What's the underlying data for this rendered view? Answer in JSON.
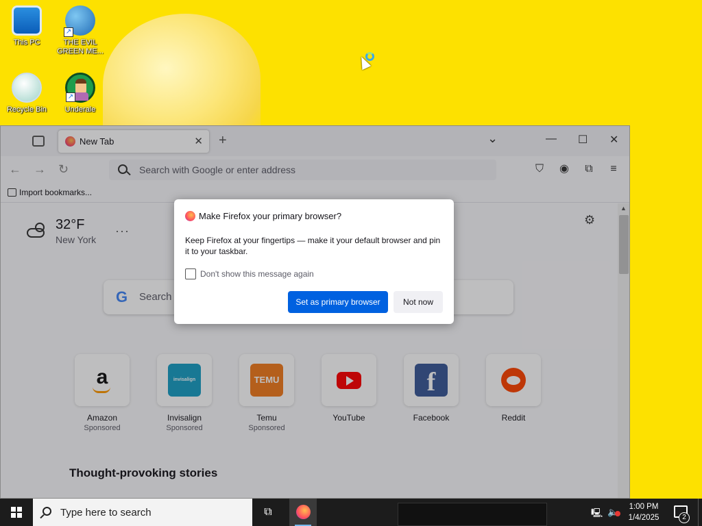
{
  "desktop": {
    "icons": [
      {
        "label": "This PC"
      },
      {
        "label": "THE EVIL GREEN ME..."
      },
      {
        "label": "Recycle Bin"
      },
      {
        "label": "Underale"
      }
    ]
  },
  "browser": {
    "tab": {
      "title": "New Tab",
      "close": "✕"
    },
    "new_tab_symbol": "+",
    "window_controls": {
      "minimize": "—",
      "maximize": "☐",
      "close": "✕",
      "tab_list": "⌄"
    },
    "nav": {
      "back": "←",
      "forward": "→",
      "reload": "↻"
    },
    "urlbar": {
      "placeholder": "Search with Google or enter address"
    },
    "toolbar_icons": [
      "pocket-icon",
      "account-icon",
      "extensions-icon",
      "menu-icon"
    ],
    "bookmarks": {
      "import_label": "Import bookmarks..."
    }
  },
  "newtab": {
    "weather": {
      "temp": "32°F",
      "city": "New York",
      "more": "···"
    },
    "search_placeholder": "Search w",
    "google_letter": "G",
    "shortcuts": [
      {
        "name": "Amazon",
        "sponsored": "Sponsored",
        "logo": "a"
      },
      {
        "name": "Invisalign",
        "sponsored": "Sponsored",
        "logo": "invisalign"
      },
      {
        "name": "Temu",
        "sponsored": "Sponsored",
        "logo": "TEMU"
      },
      {
        "name": "YouTube",
        "sponsored": "",
        "logo": ""
      },
      {
        "name": "Facebook",
        "sponsored": "",
        "logo": "f"
      },
      {
        "name": "Reddit",
        "sponsored": "",
        "logo": ""
      }
    ],
    "stories_heading": "Thought-provoking stories"
  },
  "dialog": {
    "title": "Make Firefox your primary browser?",
    "body": "Keep Firefox at your fingertips — make it your default browser and pin it to your taskbar.",
    "checkbox_label": "Don't show this message again",
    "checkbox_checked": false,
    "primary_button": "Set as primary browser",
    "secondary_button": "Not now"
  },
  "taskbar": {
    "search_placeholder": "Type here to search",
    "time": "1:00 PM",
    "date": "1/4/2025",
    "notification_count": "2"
  },
  "colors": {
    "desktop_bg": "#fde100",
    "accent": "#0061e0",
    "taskbar_bg": "#1c1c1c"
  }
}
